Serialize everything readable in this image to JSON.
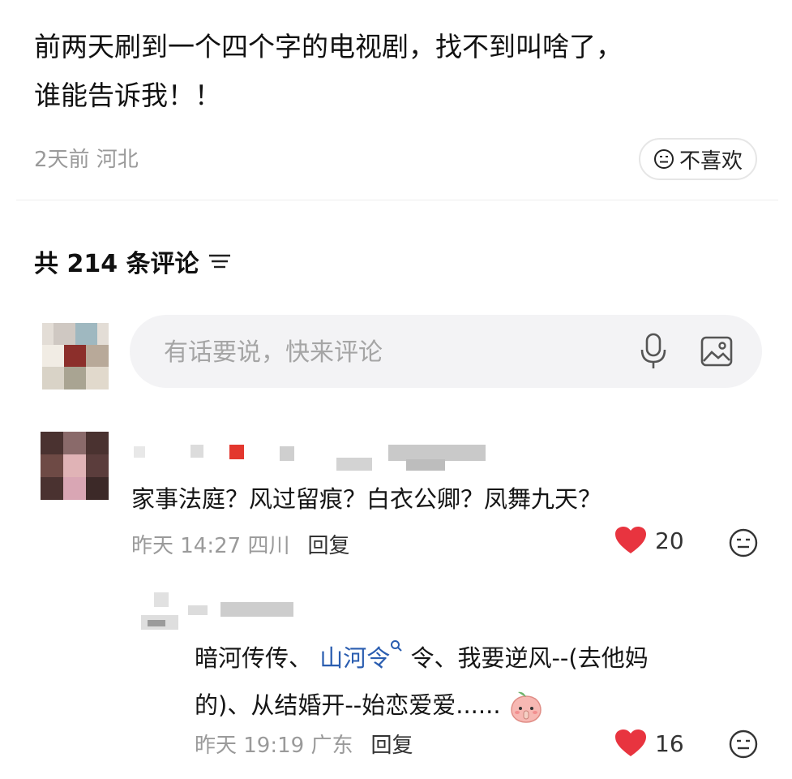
{
  "post": {
    "line1": "前两天刷到一个四个字的电视剧，找不到叫啥了，",
    "line2": "谁能告诉我！！",
    "meta": "2天前 河北",
    "dislike_label": "不喜欢"
  },
  "comments_header": {
    "count_label": "共 214 条评论"
  },
  "comment_input": {
    "placeholder": "有话要说，快来评论"
  },
  "comments": [
    {
      "text": "家事法庭？风过留痕？白衣公卿？凤舞九天？",
      "time_place": "昨天 14:27 四川",
      "reply_label": "回复",
      "likes": "20"
    },
    {
      "text_a": "暗河传传、",
      "link": "山河令",
      "text_b": " 令、我要逆风--(去他妈",
      "text_c": "的)、从结婚开--始恋爱爱......",
      "time_place": "昨天 19:19 广东",
      "reply_label": "回复",
      "likes": "16"
    }
  ],
  "colors": {
    "accent_heart": "#e8343f",
    "meta_gray": "#9a9a9a",
    "link_blue": "#2a5db0"
  },
  "icons": [
    "neutral-face-icon",
    "filter-icon",
    "mic-icon",
    "image-icon",
    "heart-icon",
    "search-icon",
    "peach-emoji"
  ]
}
